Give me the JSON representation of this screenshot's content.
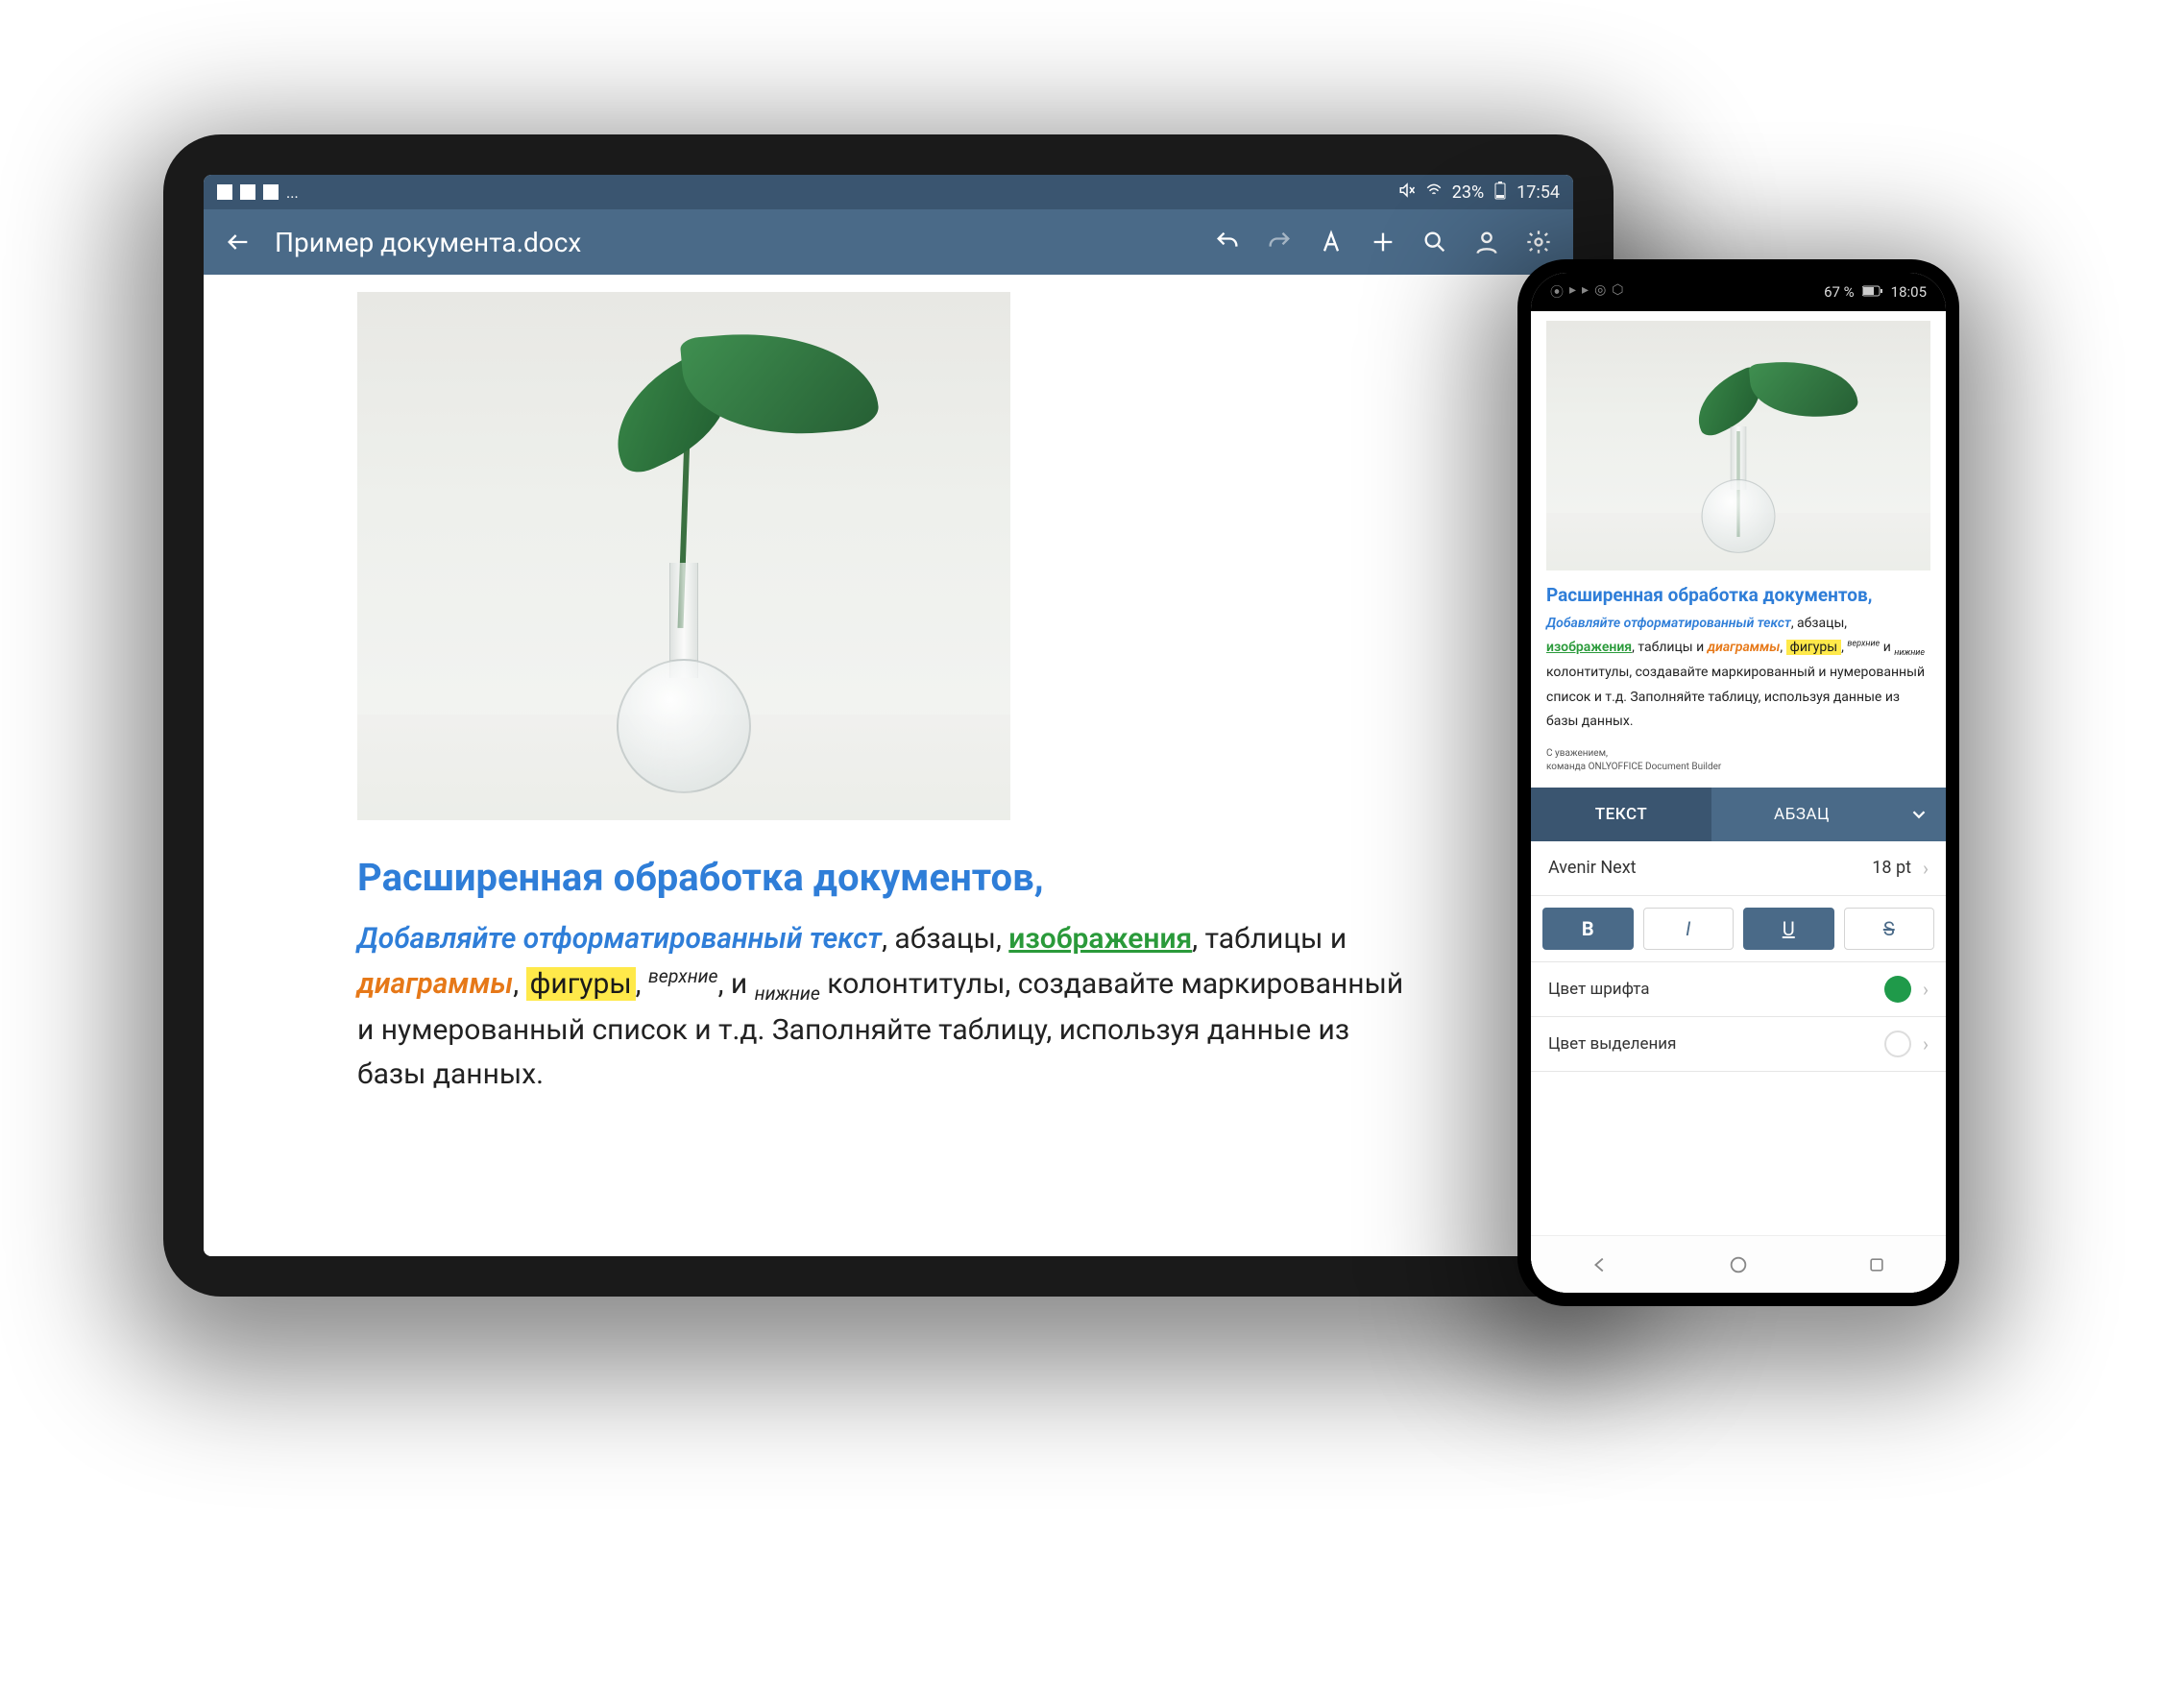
{
  "tablet": {
    "status": {
      "battery_text": "23%",
      "time": "17:54",
      "notif_more": "..."
    },
    "appbar": {
      "title": "Пример документа.docx"
    },
    "doc": {
      "heading": "Расширенная обработка документов,",
      "seg_blue_italic": "Добавляйте отформатированный текст",
      "seg_after_blue": ",  абзацы, ",
      "seg_green_ul": "изображения",
      "seg_after_green": ", таблицы и ",
      "seg_orange": "диаграммы",
      "seg_after_orange": ", ",
      "seg_highlight": "фигуры",
      "seg_after_highlight": ", ",
      "seg_super": "верхние",
      "seg_mid": ", и ",
      "seg_sub": "нижние",
      "seg_tail": " колонтитулы, создавайте маркированный и нумерованный список и т.д. Заполняйте таблицу, используя данные из базы данных."
    }
  },
  "phone": {
    "status": {
      "battery_text": "67 %",
      "time": "18:05"
    },
    "doc": {
      "heading": "Расширенная обработка документов,",
      "seg_blue_italic": "Добавляйте отформатированный текст",
      "seg_after_blue": ",  абзацы, ",
      "seg_green_ul": "изображения",
      "seg_after_green": ", таблицы и ",
      "seg_orange": "диаграммы",
      "seg_after_orange": ", ",
      "seg_highlight": "фигуры",
      "seg_after_highlight": ", ",
      "seg_super": "верхние",
      "seg_mid": " и ",
      "seg_sub": "нижние",
      "seg_tail": " колонтитулы, создавайте маркированный и нумерованный список и т.д. Заполняйте таблицу, используя данные из базы данных.",
      "sign1": "С уважением,",
      "sign2": "команда ONLYOFFICE Document Builder"
    },
    "panel": {
      "tab_text": "ТЕКСТ",
      "tab_paragraph": "АБЗАЦ",
      "font_name": "Avenir Next",
      "font_size": "18 pt",
      "btn_bold": "B",
      "btn_italic": "I",
      "btn_underline": "U",
      "btn_strike": "S",
      "color_row": "Цвет шрифта",
      "highlight_row": "Цвет выделения"
    }
  }
}
